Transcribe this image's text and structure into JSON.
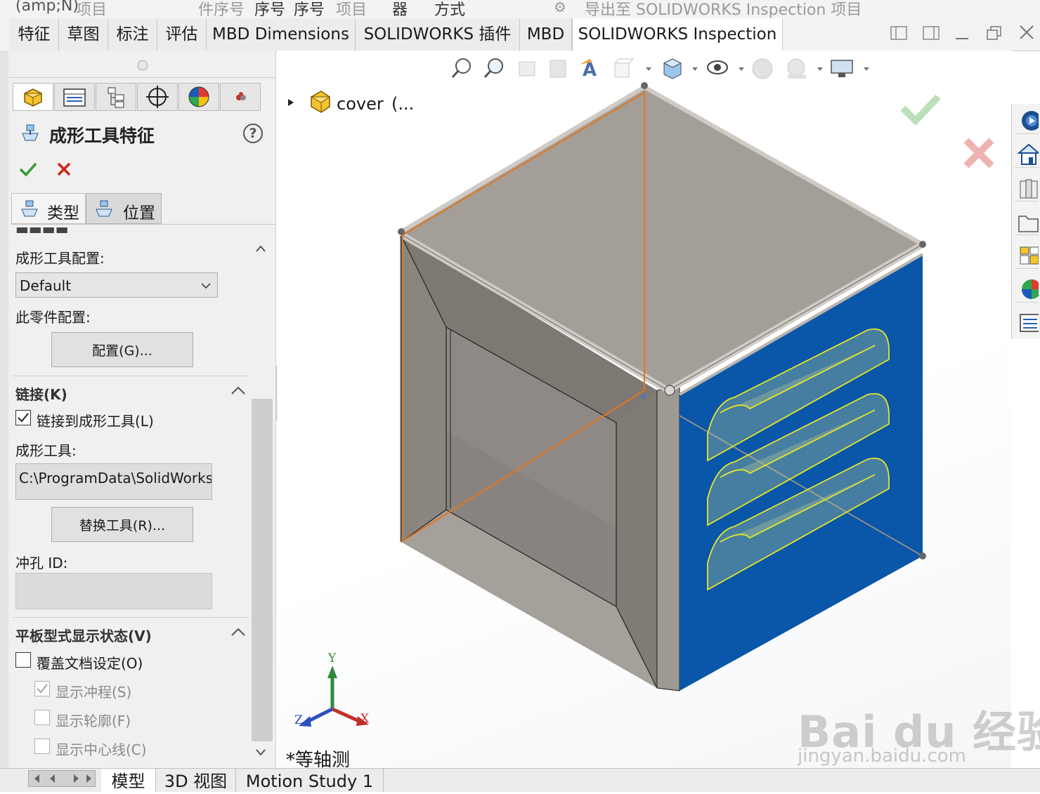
{
  "top_strip": {
    "item1": "(amp;N)",
    "item2": "项目",
    "item3": "件序号",
    "item4": "序号",
    "item5": "序号",
    "item6": "项目",
    "item7": "器",
    "item8": "方式",
    "item9": "导出至 SOLIDWORKS Inspection 项目"
  },
  "command_tabs": [
    {
      "label": "特征"
    },
    {
      "label": "草图"
    },
    {
      "label": "标注"
    },
    {
      "label": "评估"
    },
    {
      "label": "MBD Dimensions"
    },
    {
      "label": "SOLIDWORKS 插件"
    },
    {
      "label": "MBD"
    },
    {
      "label": "SOLIDWORKS Inspection"
    }
  ],
  "property_manager": {
    "title": "成形工具特征",
    "help_glyph": "?",
    "subtabs": [
      {
        "label": "类型"
      },
      {
        "label": "位置"
      }
    ],
    "config_section": {
      "tool_config_label": "成形工具配置:",
      "tool_config_value": "Default",
      "part_config_label": "此零件配置:",
      "config_button": "配置(G)..."
    },
    "link_section": {
      "title": "链接(K)",
      "link_checkbox": "链接到成形工具(L)",
      "link_checked": true,
      "tool_label": "成形工具:",
      "tool_path": "C:\\ProgramData\\SolidWorks\\S",
      "replace_button": "替换工具(R)...",
      "punch_id_label": "冲孔 ID:",
      "punch_id_value": ""
    },
    "flat_section": {
      "title": "平板型式显示状态(V)",
      "override_label": "覆盖文档设定(O)",
      "override_checked": false,
      "show_punch_label": "显示冲程(S)",
      "show_punch_checked": true,
      "show_profile_label": "显示轮廓(F)",
      "show_profile_checked": false,
      "show_centerline_label": "显示中心线(C)",
      "show_centerline_checked": false
    }
  },
  "viewport": {
    "tree_root": "cover",
    "tree_suffix": "(...",
    "view_name": "*等轴测",
    "triad": {
      "y": "Y",
      "x": "X",
      "z": "Z"
    },
    "colors": {
      "sheet": "#8f8a85",
      "face": "#0a56a8",
      "edge_highlight": "#e07820",
      "form_tool": "#e6e62a"
    }
  },
  "watermark": {
    "brand": "Bai du 经验",
    "url": "jingyan.baidu.com"
  },
  "bottom_tabs": [
    {
      "label": "模型"
    },
    {
      "label": "3D 视图"
    },
    {
      "label": "Motion Study 1"
    }
  ]
}
